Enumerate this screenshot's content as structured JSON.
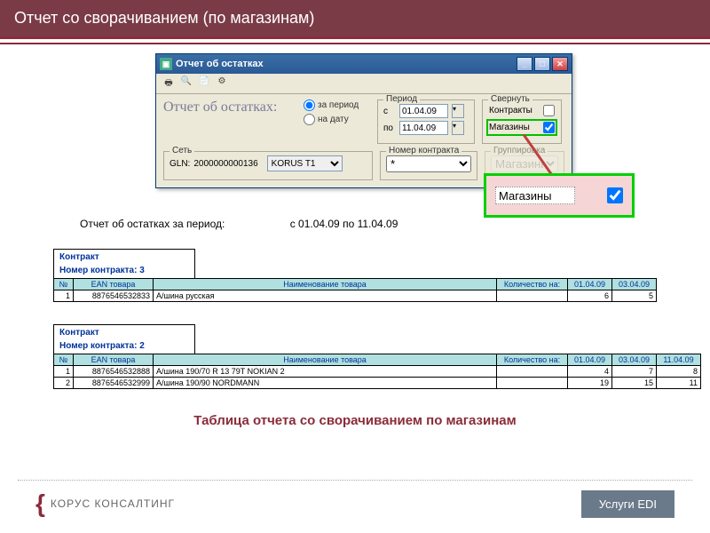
{
  "slide": {
    "title": "Отчет со сворачиванием (по магазинам)"
  },
  "window": {
    "title": "Отчет об остатках",
    "form_title": "Отчет об остатках:",
    "gln_label": "GLN:",
    "gln_value": "2000000000136",
    "network_value": "KORUS T1",
    "radio_period": "за период",
    "radio_date": "на дату",
    "period_legend": "Период",
    "date_from_label": "с",
    "date_from": "01.04.09",
    "date_to_label": "по",
    "date_to": "11.04.09",
    "contract_legend": "Номер контракта",
    "contract_value": "*",
    "collapse_legend": "Свернуть",
    "collapse_contracts": "Контракты",
    "collapse_stores": "Магазины",
    "group_legend": "Группировка",
    "group_value": "Магазины",
    "network_legend": "Сеть"
  },
  "callout": {
    "label": "Магазины"
  },
  "report": {
    "title_text": "Отчет об остатках за период:",
    "dates_text": "с 01.04.09 по 11.04.09"
  },
  "section1": {
    "contract_label": "Контракт",
    "contract_num_label": "Номер контракта: 3",
    "headers": {
      "num": "№",
      "ean": "EAN товара",
      "name": "Наименование товара",
      "qty": "Количество на:",
      "d1": "01.04.09",
      "d2": "03.04.09"
    },
    "rows": [
      {
        "n": "1",
        "ean": "8876546532833",
        "name": "А/шина русская",
        "v1": "6",
        "v2": "5"
      }
    ]
  },
  "section2": {
    "contract_label": "Контракт",
    "contract_num_label": "Номер контракта: 2",
    "headers": {
      "num": "№",
      "ean": "EAN товара",
      "name": "Наименование товара",
      "qty": "Количество на:",
      "d1": "01.04.09",
      "d2": "03.04.09",
      "d3": "11.04.09"
    },
    "rows": [
      {
        "n": "1",
        "ean": "8876546532888",
        "name": "А/шина 190/70 R 13 79T NOKIAN 2",
        "v1": "4",
        "v2": "7",
        "v3": "8"
      },
      {
        "n": "2",
        "ean": "8876546532999",
        "name": "А/шина 190/90 NORDMANN",
        "v1": "19",
        "v2": "15",
        "v3": "11"
      }
    ]
  },
  "caption": "Таблица отчета со сворачиванием по магазинам",
  "footer": {
    "company": "КОРУС КОНСАЛТИНГ",
    "tag": "Услуги EDI"
  }
}
